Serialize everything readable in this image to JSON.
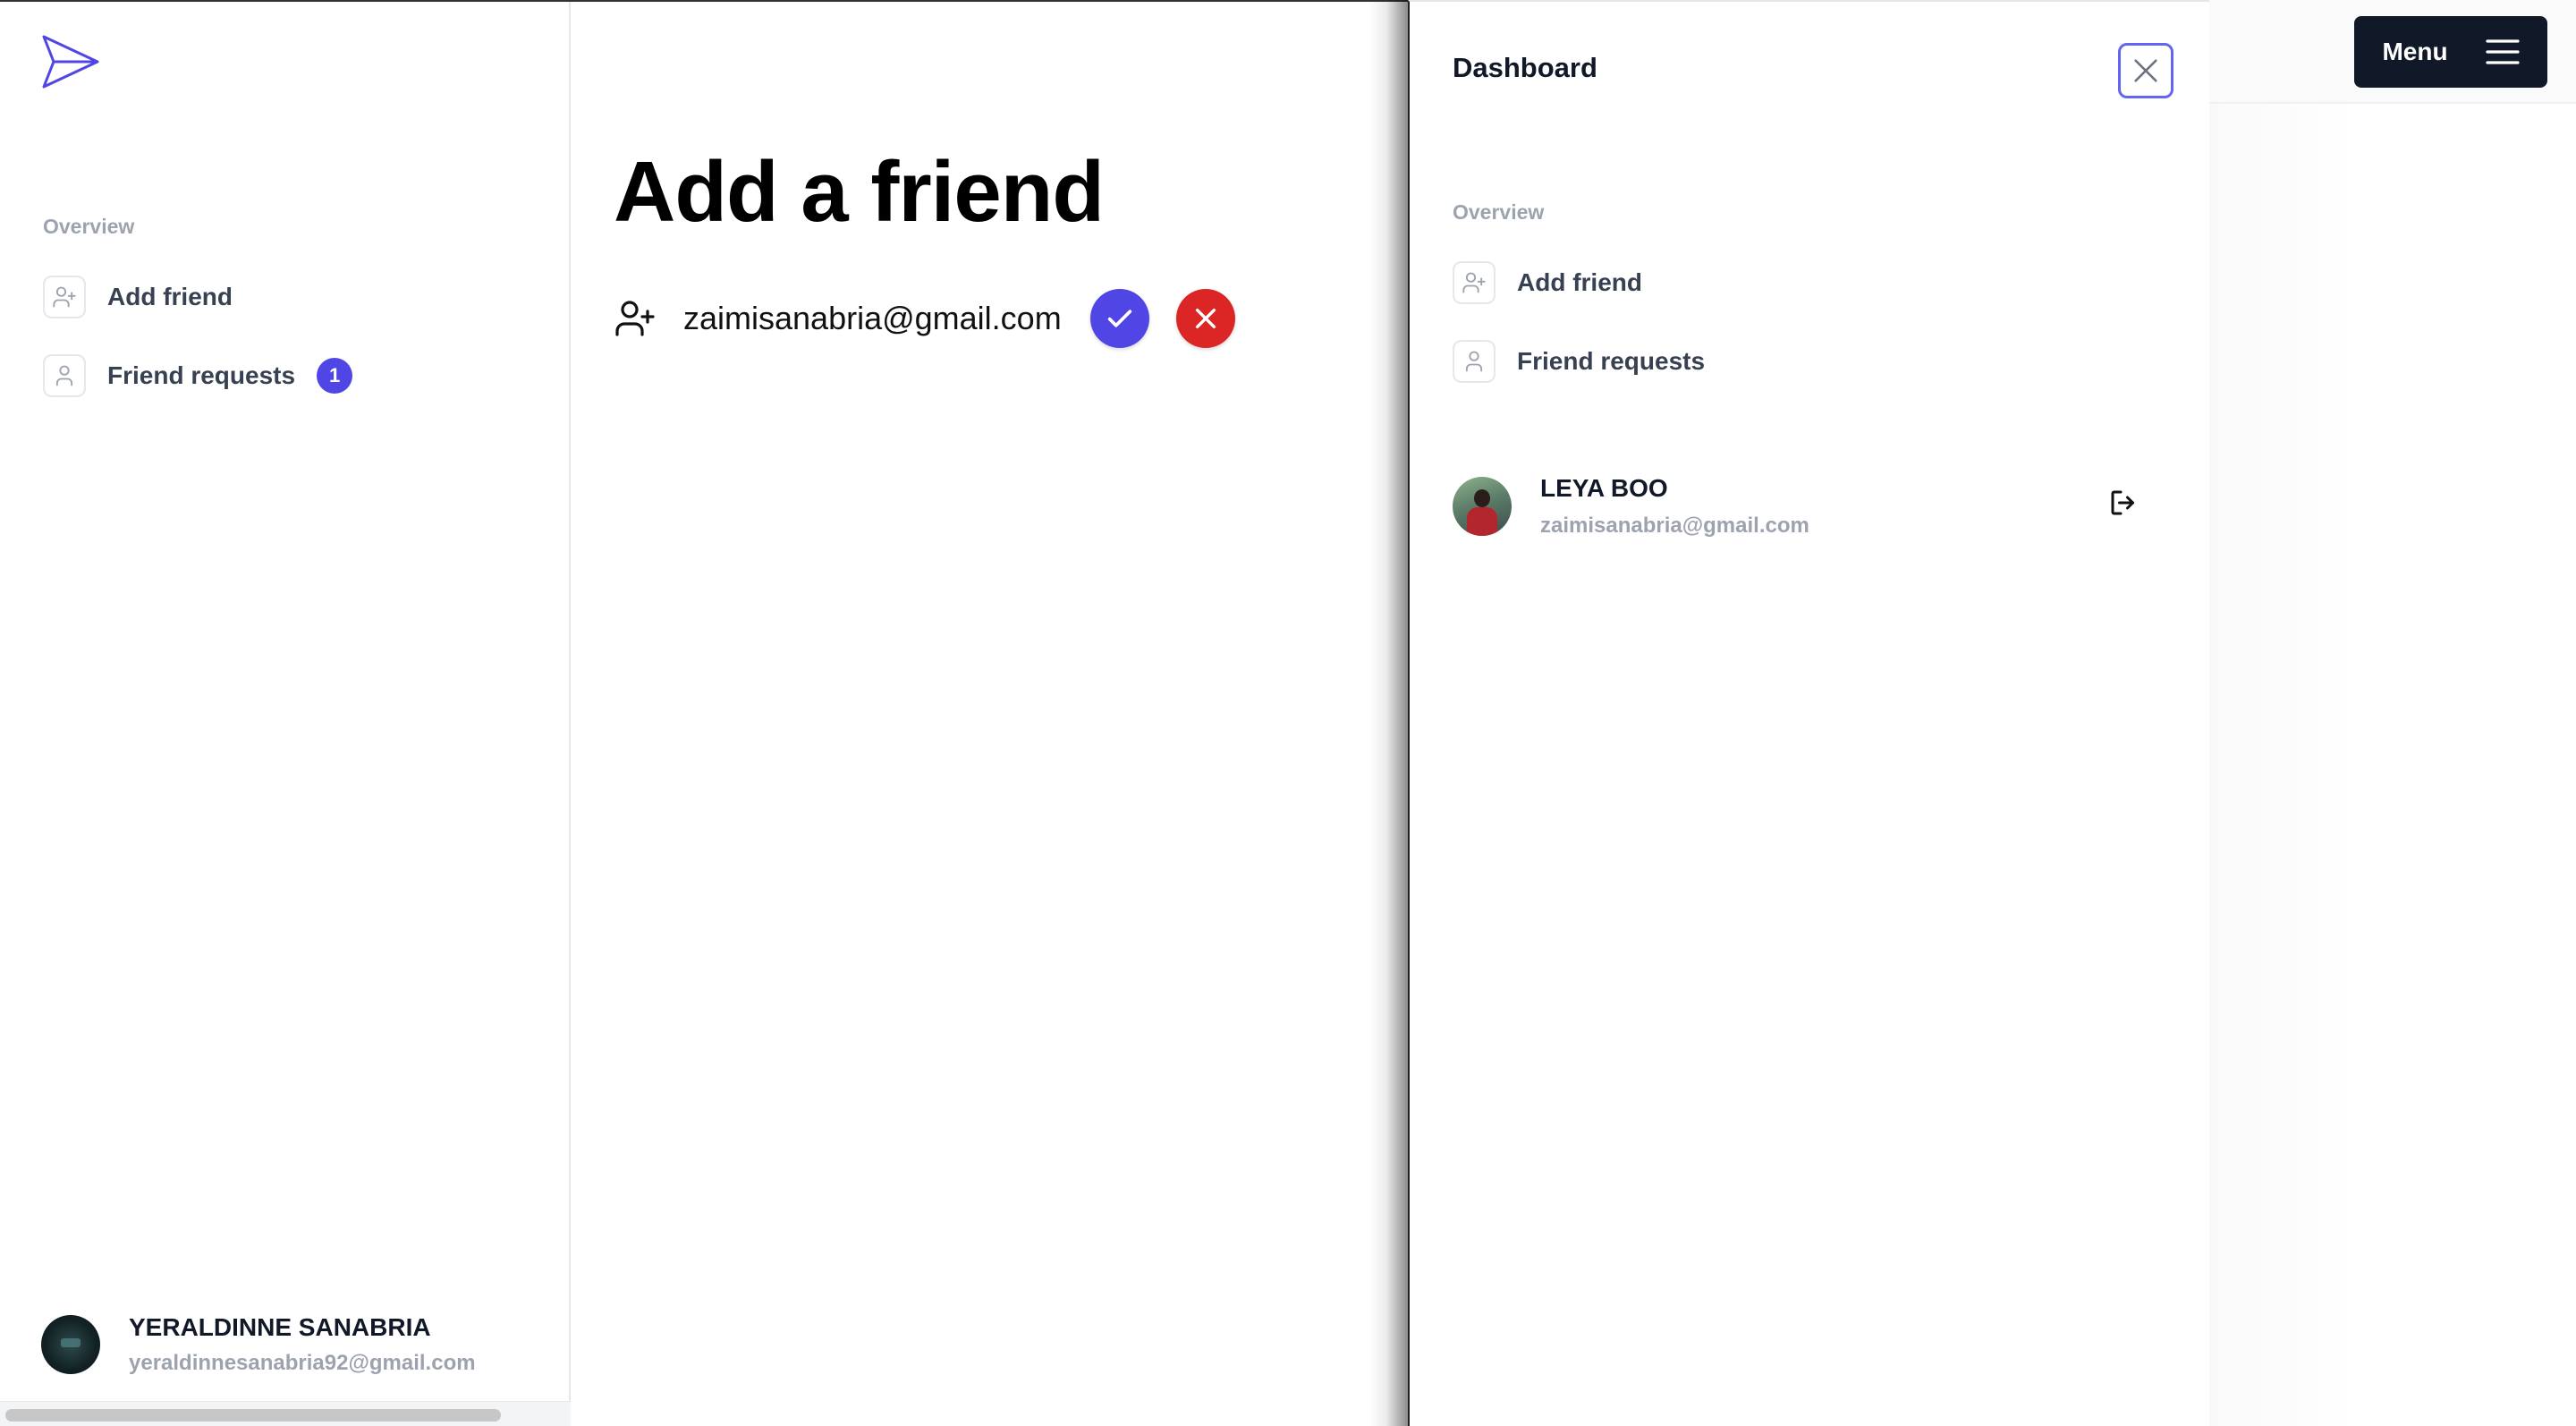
{
  "sidebar": {
    "overview_label": "Overview",
    "items": [
      {
        "label": "Add friend",
        "icon": "user-plus-icon"
      },
      {
        "label": "Friend requests",
        "icon": "user-icon",
        "badge": "1"
      }
    ],
    "user": {
      "name": "YERALDINNE SANABRIA",
      "email": "yeraldinnesanabria92@gmail.com"
    }
  },
  "main": {
    "title": "Add a friend",
    "request": {
      "email": "zaimisanabria@gmail.com",
      "accept_icon": "check-icon",
      "deny_icon": "x-icon"
    }
  },
  "topbar": {
    "menu_label": "Menu"
  },
  "drawer": {
    "title": "Dashboard",
    "overview_label": "Overview",
    "items": [
      {
        "label": "Add friend",
        "icon": "user-plus-icon"
      },
      {
        "label": "Friend requests",
        "icon": "user-icon"
      }
    ],
    "user": {
      "name": "LEYA BOO",
      "email": "zaimisanabria@gmail.com"
    }
  },
  "colors": {
    "accent": "#4f46e5",
    "danger": "#dc2626",
    "dark_button": "#111827",
    "muted_text": "#9ca3af"
  }
}
